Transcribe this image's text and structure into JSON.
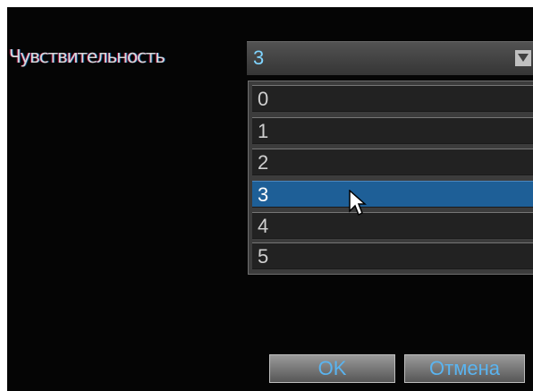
{
  "sensitivity": {
    "label": "Чувствительность",
    "value": "3",
    "options": [
      "0",
      "1",
      "2",
      "3",
      "4",
      "5"
    ]
  },
  "buttons": {
    "ok_label": "OK",
    "cancel_label": "Отмена"
  },
  "colors": {
    "selection": "#1e5f97",
    "button_text": "#5ab4f0",
    "value_text": "#7fd4ff"
  }
}
